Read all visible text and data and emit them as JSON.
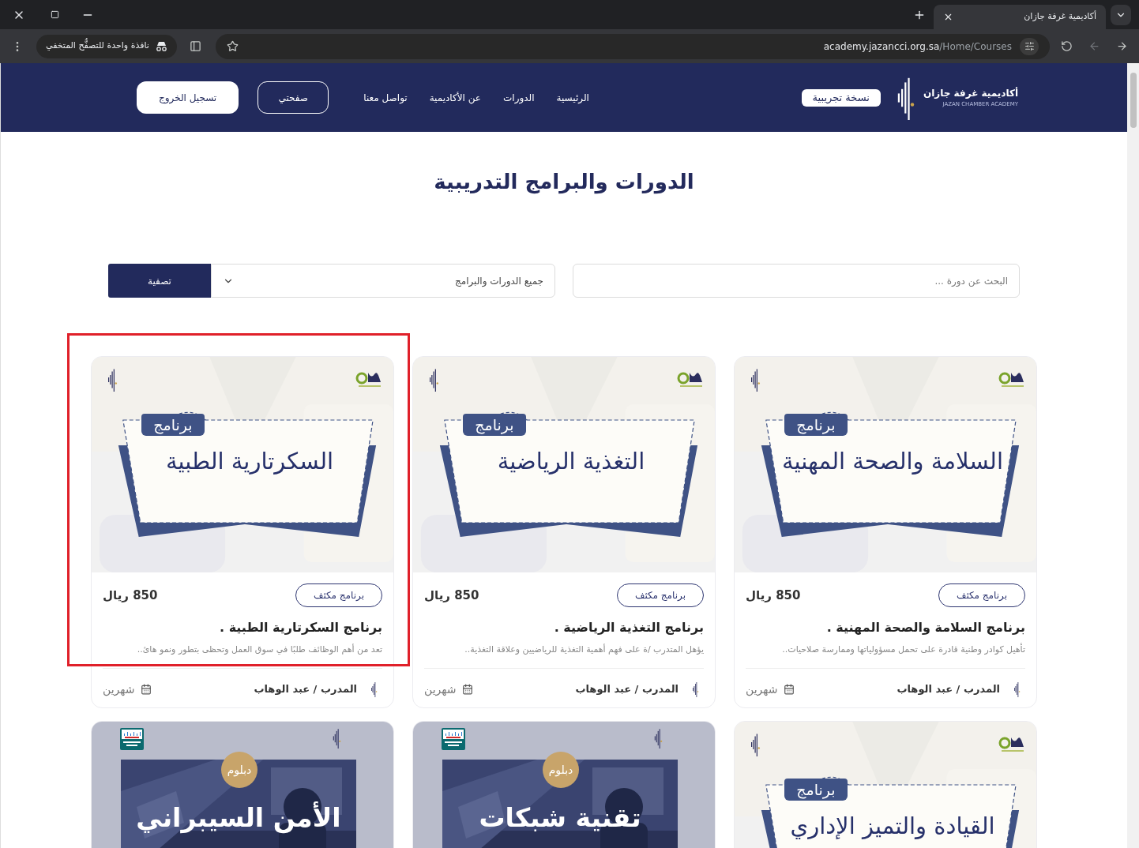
{
  "browser": {
    "tab_title": "أكاديمية غرفة جازان",
    "url_host": "academy.jazancci.org.sa",
    "url_path": "/Home/Courses",
    "incognito_label": "نافذة واحدة للتصفُّح المتخفي"
  },
  "header": {
    "logo_title": "أكاديمية غرفة جازان",
    "logo_subtitle": "JAZAN CHAMBER ACADEMY",
    "beta_badge": "نسخة تجريبية",
    "nav": [
      "الرئيسية",
      "الدورات",
      "عن الأكاديمية",
      "تواصل معنا"
    ],
    "buttons": [
      {
        "label": "صفحتي",
        "kind": "outline"
      },
      {
        "label": "تسجيل الخروج",
        "kind": "solid"
      }
    ]
  },
  "page_title": "الدورات والبرامج التدريبية",
  "filters": {
    "search": {
      "placeholder": "البحث عن دورة ..."
    },
    "category": {
      "value": "جميع الدورات والبرامج"
    },
    "button": "تصفية"
  },
  "courses": [
    {
      "kind": "program",
      "highlighted": false,
      "banner": {
        "tag": "برنامج",
        "title": "السلامة والصحة المهنية"
      },
      "badge": "برنامج مكثف",
      "price": "850 ريال",
      "title": "برنامج السلامة والصحة المهنية .",
      "description": "تأهيل كوادر وطنية قادرة على تحمل مسؤولياتها وممارسة صلاحيات..",
      "trainer": "المدرب / عبد الوهاب",
      "duration": "شهرين"
    },
    {
      "kind": "program",
      "highlighted": false,
      "banner": {
        "tag": "برنامج",
        "title": "التغذية الرياضية"
      },
      "badge": "برنامج مكثف",
      "price": "850 ريال",
      "title": "برنامج التغذية الرياضية .",
      "description": "يؤهل المتدرب /ة على فهم أهمية التغذية للرياضيين وعلاقة التغذية..",
      "trainer": "المدرب / عبد الوهاب",
      "duration": "شهرين"
    },
    {
      "kind": "program",
      "highlighted": true,
      "banner": {
        "tag": "برنامج",
        "title": "السكرتارية الطبية"
      },
      "badge": "برنامج مكثف",
      "price": "850 ريال",
      "title": "برنامج السكرتارية الطبية .",
      "description": "تعد من أهم الوظائف طلبًا في سوق العمل وتحظى بتطور ونمو هائ..",
      "trainer": "المدرب / عبد الوهاب",
      "duration": "شهرين"
    },
    {
      "kind": "program",
      "highlighted": false,
      "banner": {
        "tag": "برنامج",
        "title": "القيادة والتميز الإداري"
      }
    },
    {
      "kind": "diploma",
      "highlighted": false,
      "banner": {
        "tag": "دبلوم",
        "title": "تقنية شبكات"
      }
    },
    {
      "kind": "diploma",
      "highlighted": false,
      "banner": {
        "tag": "دبلوم",
        "title": "الأمن السيبراني"
      }
    }
  ]
}
